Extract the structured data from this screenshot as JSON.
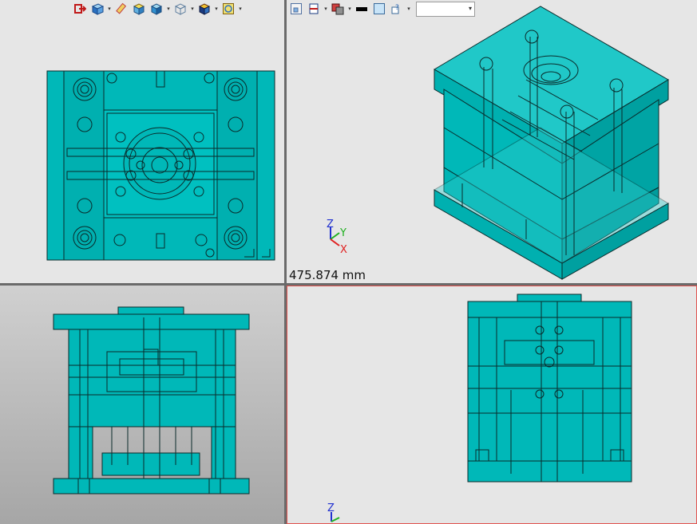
{
  "toolbar_left": {
    "buttons": [
      {
        "icon": "exit-icon"
      },
      {
        "icon": "view-cube-icon",
        "dropdown": true
      },
      {
        "icon": "eraser-icon"
      },
      {
        "icon": "shaded-cube-icon"
      },
      {
        "icon": "blue-cube-icon",
        "dropdown": true
      },
      {
        "icon": "wireframe-cube-icon",
        "dropdown": true
      },
      {
        "icon": "half-shaded-cube-icon",
        "dropdown": true
      },
      {
        "icon": "target-box-icon",
        "dropdown": true
      }
    ]
  },
  "toolbar_right": {
    "buttons": [
      {
        "icon": "zoom-fit-icon"
      },
      {
        "icon": "section-view-icon",
        "dropdown": true
      },
      {
        "icon": "display-mode-icon",
        "dropdown": true
      },
      {
        "icon": "line-color-icon"
      },
      {
        "icon": "fill-color-icon"
      },
      {
        "icon": "info-icon",
        "dropdown": true
      }
    ],
    "combo_value": ""
  },
  "measurement": "475.874 mm",
  "axes": {
    "z": "Z",
    "y": "Y",
    "x": "X"
  },
  "colors": {
    "model": "#00b8b8",
    "edge": "#0a2a2a",
    "active_border": "#e0534f",
    "axis_x": "#e02020",
    "axis_y": "#20b020",
    "axis_z": "#2030d0"
  }
}
